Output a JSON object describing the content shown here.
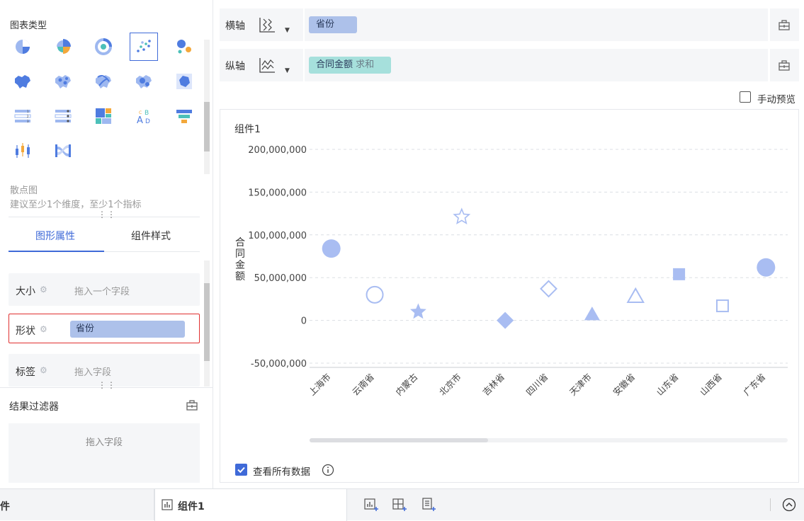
{
  "left": {
    "chart_types_title": "图表类型",
    "chart_types": [
      {
        "icon": "pie-chart-icon"
      },
      {
        "icon": "rose-pie-chart-icon"
      },
      {
        "icon": "donut-chart-icon"
      },
      {
        "icon": "scatter-chart-icon",
        "selected": true
      },
      {
        "icon": "bubble-chart-icon"
      },
      {
        "icon": "region-map-icon"
      },
      {
        "icon": "point-map-icon"
      },
      {
        "icon": "flow-map-icon"
      },
      {
        "icon": "heat-map-icon"
      },
      {
        "icon": "custom-map-icon"
      },
      {
        "icon": "table-chart-icon"
      },
      {
        "icon": "detail-table-icon"
      },
      {
        "icon": "treemap-chart-icon"
      },
      {
        "icon": "word-cloud-icon"
      },
      {
        "icon": "funnel-chart-icon"
      },
      {
        "icon": "candlestick-chart-icon"
      },
      {
        "icon": "sankey-chart-icon"
      }
    ],
    "selected_chart_name": "散点图",
    "selected_chart_hint": "建议至少1个维度，至少1个指标",
    "tabs": [
      {
        "label": "图形属性",
        "active": true
      },
      {
        "label": "组件样式",
        "active": false
      }
    ],
    "props": {
      "size_label": "大小",
      "size_placeholder": "拖入一个字段",
      "shape_label": "形状",
      "shape_value": "省份",
      "tag_label": "标签",
      "tag_placeholder": "拖入字段"
    },
    "filter_title": "结果过滤器",
    "filter_placeholder": "拖入字段"
  },
  "axes": {
    "x_label": "横轴",
    "x_field": "省份",
    "y_label": "纵轴",
    "y_field": "合同金额",
    "y_agg": "求和"
  },
  "manual_preview": "手动预览",
  "view_all_data": "查看所有数据",
  "bottom": {
    "left_fragment": "件",
    "sheet_tab": "组件1"
  },
  "colors": {
    "accent": "#3f6ad8",
    "point": "#a9bdf2",
    "highlight_border": "#e03030"
  },
  "chart_data": {
    "type": "scatter",
    "title": "组件1",
    "ylabel": "合同金额",
    "xlabel": "",
    "ylim": [
      -50000000,
      200000000
    ],
    "y_ticks": [
      -50000000,
      0,
      50000000,
      100000000,
      150000000,
      200000000
    ],
    "y_tick_labels": [
      "-50,000,000",
      "0",
      "50,000,000",
      "100,000,000",
      "150,000,000",
      "200,000,000"
    ],
    "grid": true,
    "categories": [
      "上海市",
      "云南省",
      "内蒙古",
      "北京市",
      "吉林省",
      "四川省",
      "天津市",
      "安徽省",
      "山东省",
      "山西省",
      "广东省"
    ],
    "values": [
      84000000,
      30000000,
      10000000,
      121000000,
      0,
      37000000,
      7000000,
      28000000,
      54000000,
      17000000,
      62000000
    ],
    "shapes": [
      "circle",
      "circle-outline",
      "star",
      "star-outline",
      "diamond",
      "diamond-outline",
      "triangle",
      "triangle-outline",
      "square",
      "square-outline",
      "circle"
    ]
  }
}
